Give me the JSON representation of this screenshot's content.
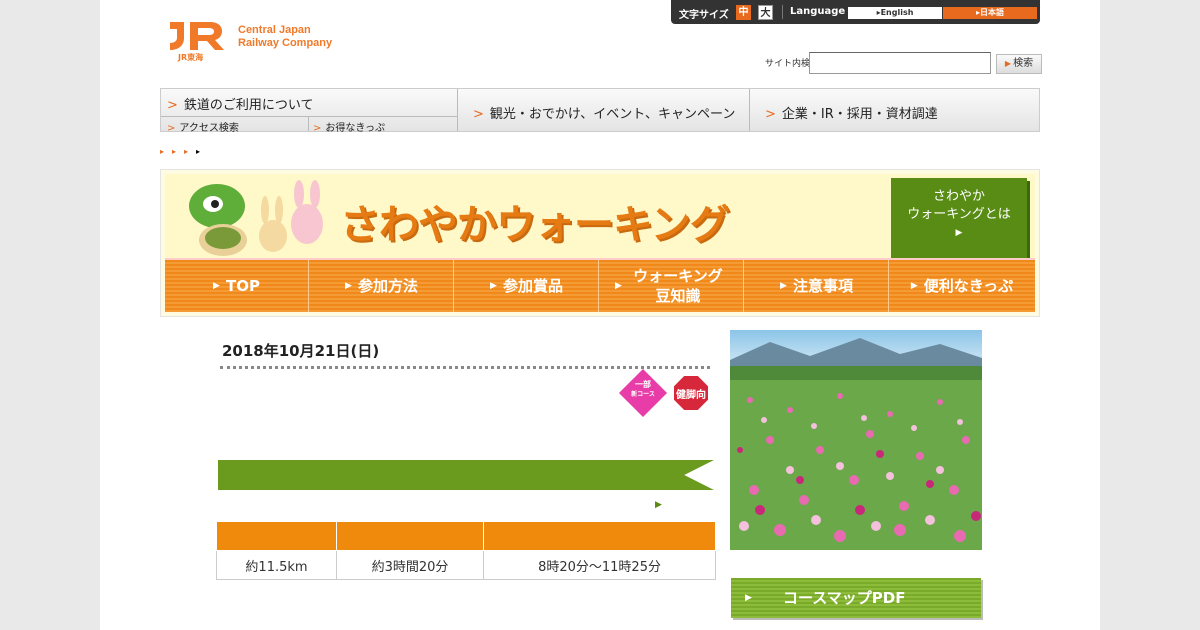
{
  "header": {
    "logo_line1": "Central Japan",
    "logo_line2": "Railway Company",
    "logo_sub": "JR東海",
    "font_size_label": "文字サイズ",
    "size_medium": "中",
    "size_large": "大",
    "language_label": "Language",
    "lang_english": "English",
    "lang_japanese": "日本語",
    "search_label": "サイト内検索",
    "search_button": "検索"
  },
  "nav": {
    "rail_label": "鉄道のご利用について",
    "access_label": "アクセス検索",
    "tickets_label": "お得なきっぷ",
    "tourism_label": "観光・おでかけ、イベント、キャンペーン",
    "corporate_label": "企業・IR・採用・資材調達"
  },
  "banner": {
    "title": "さわやかウォーキング",
    "about_line1": "さわやか",
    "about_line2": "ウォーキングとは",
    "menu": [
      "TOP",
      "参加方法",
      "参加賞品",
      "ウォーキング豆知識",
      "注意事項",
      "便利なきっぷ"
    ]
  },
  "event": {
    "date": "2018年10月21日(日)",
    "badge_a": "一部",
    "badge_a_sub": "新コース",
    "badge_b": "健脚向",
    "title": "",
    "course_name": "",
    "course_link": "",
    "table_headers": [
      "",
      "",
      ""
    ],
    "distance": "約11.5km",
    "time": "約3時間20分",
    "start_time": "8時20分〜11時25分"
  },
  "side": {
    "caption": "",
    "pdf_button": "コースマップPDF"
  },
  "colors": {
    "accent": "#f07a2a",
    "green": "#6a9a1e",
    "orange": "#ef8a0c"
  }
}
